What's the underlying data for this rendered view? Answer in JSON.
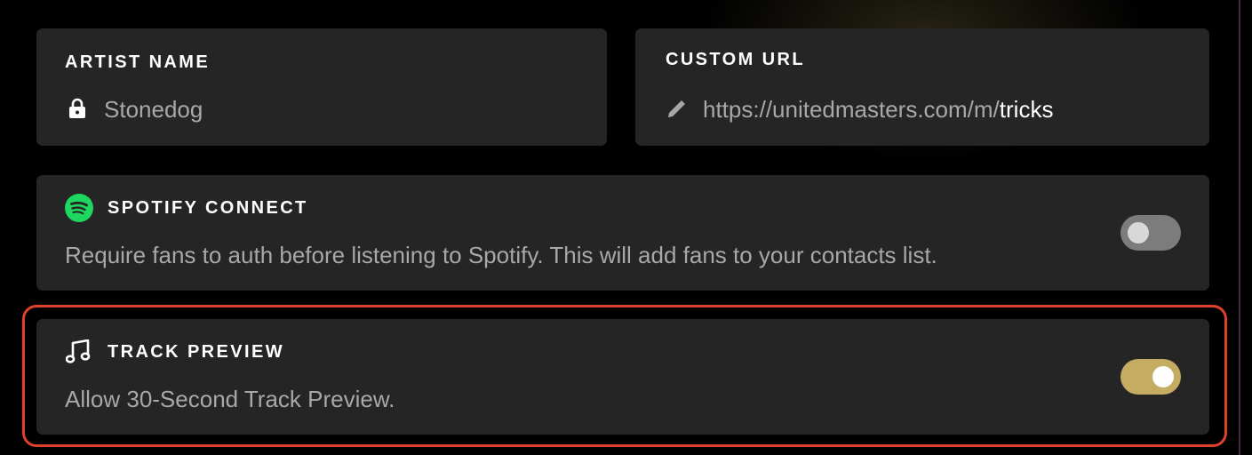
{
  "artist": {
    "title": "ARTIST NAME",
    "value": "Stonedog",
    "icon": "lock-icon"
  },
  "custom_url": {
    "title": "CUSTOM URL",
    "prefix": "https://unitedmasters.com/m/",
    "slug": "tricks",
    "icon": "pencil-icon"
  },
  "spotify_connect": {
    "title": "SPOTIFY CONNECT",
    "description": "Require fans to auth before listening to Spotify. This will add fans to your contacts list.",
    "icon": "spotify-icon",
    "enabled": false
  },
  "track_preview": {
    "title": "TRACK PREVIEW",
    "description": "Allow 30-Second Track Preview.",
    "icon": "music-note-icon",
    "enabled": true
  },
  "colors": {
    "background": "#000000",
    "card": "#252525",
    "toggle_on": "#c4ad62",
    "toggle_off": "#7c7c7c",
    "spotify_green": "#1ed760",
    "highlight": "#e0412b"
  }
}
